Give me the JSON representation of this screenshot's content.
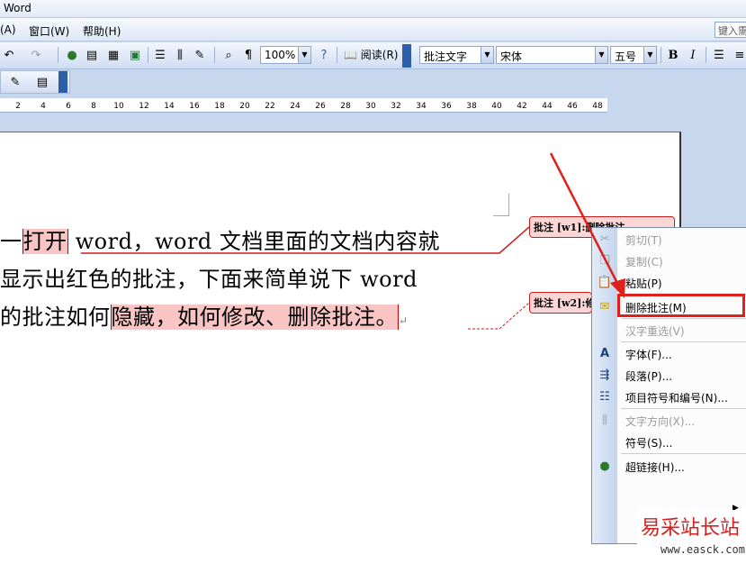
{
  "window": {
    "title": "Word"
  },
  "menubar": {
    "items": [
      "(A)",
      "窗口(W)",
      "帮助(H)"
    ],
    "help_box": "键入需"
  },
  "toolbar": {
    "zoom": "100%",
    "read_button": "阅读(R)",
    "style": "批注文字",
    "font": "宋体",
    "font_size": "五号",
    "bold": "B",
    "italic": "I"
  },
  "ruler": {
    "ticks": [
      "2",
      "4",
      "6",
      "8",
      "10",
      "12",
      "14",
      "16",
      "18",
      "20",
      "22",
      "24",
      "26",
      "28",
      "30",
      "32",
      "34",
      "36",
      "38",
      "40",
      "42",
      "44",
      "46",
      "48"
    ]
  },
  "document": {
    "line1": {
      "pre": "一",
      "highlight": "打开",
      "post": " word，word 文档里面的文档内容就"
    },
    "line2": "显示出红色的批注，下面来简单说下  word",
    "line3": {
      "pre": "的批注如何",
      "highlight": "隐藏，如何修改、删除批注。"
    }
  },
  "comments": [
    {
      "label": "批注 [w1]:",
      "text": "删除批注"
    },
    {
      "label": "批注 [w2]:",
      "text": "修改"
    }
  ],
  "context_menu": {
    "items": [
      {
        "label": "剪切(T)",
        "icon": "scissors-icon",
        "disabled": true
      },
      {
        "label": "复制(C)",
        "icon": "copy-icon",
        "disabled": true
      },
      {
        "label": "粘贴(P)",
        "icon": "paste-icon",
        "disabled": false
      },
      {
        "label": "删除批注(M)",
        "icon": "delete-comment-icon",
        "disabled": false,
        "highlighted": true
      },
      {
        "label": "汉字重选(V)",
        "icon": "",
        "disabled": true
      },
      {
        "label": "字体(F)...",
        "icon": "font-icon",
        "disabled": false
      },
      {
        "label": "段落(P)...",
        "icon": "paragraph-icon",
        "disabled": false
      },
      {
        "label": "项目符号和编号(N)...",
        "icon": "bullets-icon",
        "disabled": false
      },
      {
        "label": "文字方向(X)...",
        "icon": "text-direction-icon",
        "disabled": true
      },
      {
        "label": "符号(S)...",
        "icon": "",
        "disabled": false
      },
      {
        "label": "超链接(H)...",
        "icon": "hyperlink-icon",
        "disabled": false
      }
    ]
  },
  "watermark": {
    "name": "易采站长站",
    "url": "www.easck.com"
  },
  "colors": {
    "comment_red": "#c81e1e",
    "highlight": "#f9c4c4",
    "arrow": "#e0201b",
    "accent_blue": "#2d5ea8"
  }
}
